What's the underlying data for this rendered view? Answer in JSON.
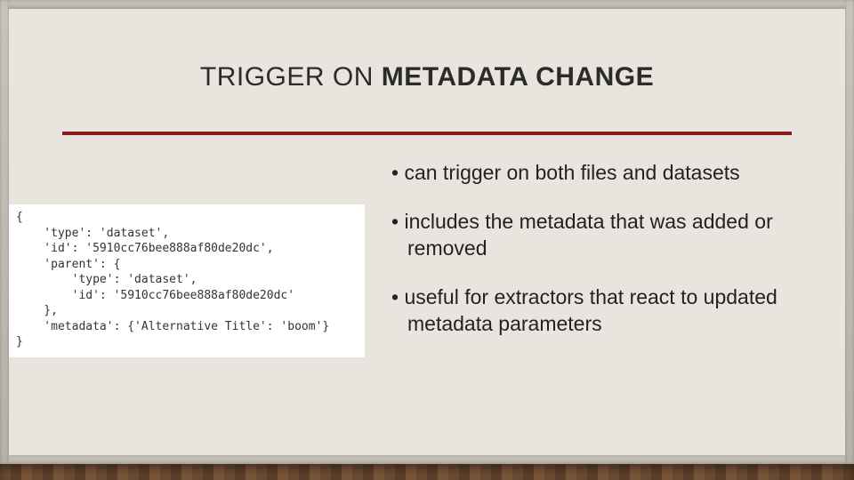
{
  "title": {
    "light": "TRIGGER ON ",
    "heavy": "METADATA CHANGE"
  },
  "code": "{\n    'type': 'dataset',\n    'id': '5910cc76bee888af80de20dc',\n    'parent': {\n        'type': 'dataset',\n        'id': '5910cc76bee888af80de20dc'\n    },\n    'metadata': {'Alternative Title': 'boom'}\n}",
  "bullets": [
    "can trigger on both files and datasets",
    "includes the metadata that was added or removed",
    "useful for extractors that react to updated metadata parameters"
  ]
}
